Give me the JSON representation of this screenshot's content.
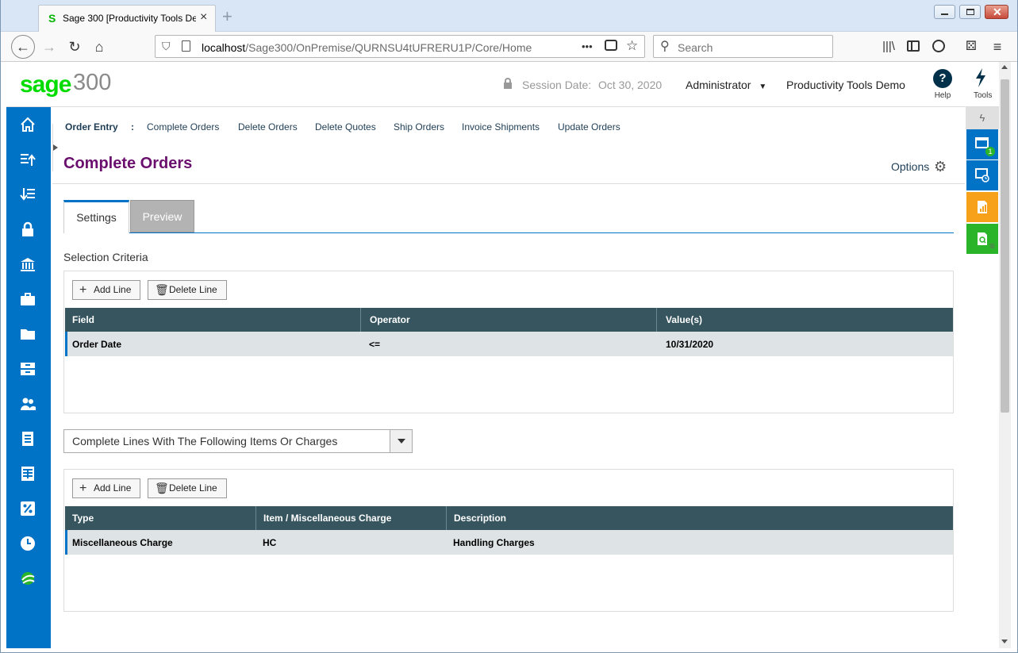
{
  "browser": {
    "tab_title": "Sage 300 [Productivity Tools De",
    "tab_favicon": "S",
    "new_tab": "+",
    "url_host": "localhost",
    "url_path": "/Sage300/OnPremise/QURNSU4tUFRERU1P/Core/Home",
    "url_dots": "•••",
    "search_placeholder": "Search"
  },
  "header": {
    "logo_sage": "sage",
    "logo_num": "300",
    "session_label": "Session Date:",
    "session_date": "Oct 30, 2020",
    "user": "Administrator",
    "company": "Productivity Tools Demo",
    "help_label": "Help",
    "help_glyph": "?",
    "tools_label": "Tools"
  },
  "breadcrumb": {
    "module": "Order Entry",
    "separator": ":",
    "items": [
      "Complete Orders",
      "Delete Orders",
      "Delete Quotes",
      "Ship Orders",
      "Invoice Shipments",
      "Update Orders"
    ]
  },
  "page": {
    "title": "Complete Orders",
    "options_label": "Options"
  },
  "tabs": [
    {
      "label": "Settings",
      "active": true
    },
    {
      "label": "Preview",
      "active": false
    }
  ],
  "selection": {
    "label": "Selection Criteria",
    "add_line": "Add Line",
    "delete_line": "Delete Line",
    "columns": [
      "Field",
      "Operator",
      "Value(s)"
    ],
    "rows": [
      {
        "field": "Order Date",
        "operator": "<=",
        "value": "10/31/2020"
      }
    ]
  },
  "lines_option": {
    "selected": "Complete Lines With The Following Items Or Charges"
  },
  "items": {
    "add_line": "Add Line",
    "delete_line": "Delete Line",
    "columns": [
      "Type",
      "Item / Miscellaneous Charge",
      "Description"
    ],
    "rows": [
      {
        "type": "Miscellaneous Charge",
        "item": "HC",
        "description": "Handling Charges"
      }
    ]
  },
  "rightbar": {
    "window_badge": "1"
  },
  "colors": {
    "nav_blue": "#0073c6",
    "title_purple": "#6b0f6e",
    "grid_header": "#36555f",
    "sage_green": "#00dc00",
    "rb_orange": "#f7a11a",
    "rb_green": "#2ab42a"
  }
}
